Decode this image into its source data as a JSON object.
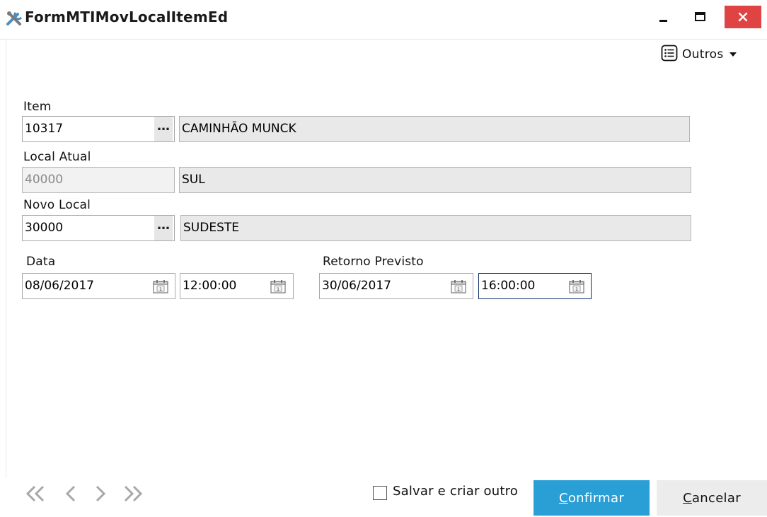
{
  "window": {
    "title": "FormMTIMovLocalItemEd",
    "close_color": "#e04343"
  },
  "toolbar": {
    "outros_label": "Outros",
    "outros_icon": "list-icon"
  },
  "form": {
    "item": {
      "label": "Item",
      "code": "10317",
      "description": "CAMINHÃO MUNCK"
    },
    "local_atual": {
      "label": "Local Atual",
      "code": "40000",
      "description": "SUL"
    },
    "novo_local": {
      "label": "Novo Local",
      "code": "30000",
      "description": "SUDESTE"
    },
    "data": {
      "label": "Data",
      "date": "08/06/2017",
      "time": "12:00:00"
    },
    "retorno": {
      "label": "Retorno Previsto",
      "date": "30/06/2017",
      "time": "16:00:00"
    }
  },
  "footer": {
    "save_and_create_label": "Salvar e criar outro",
    "save_and_create_checked": false,
    "confirm_label": "Confirmar",
    "cancel_label": "Cancelar",
    "accent": "#2a9fd6"
  }
}
